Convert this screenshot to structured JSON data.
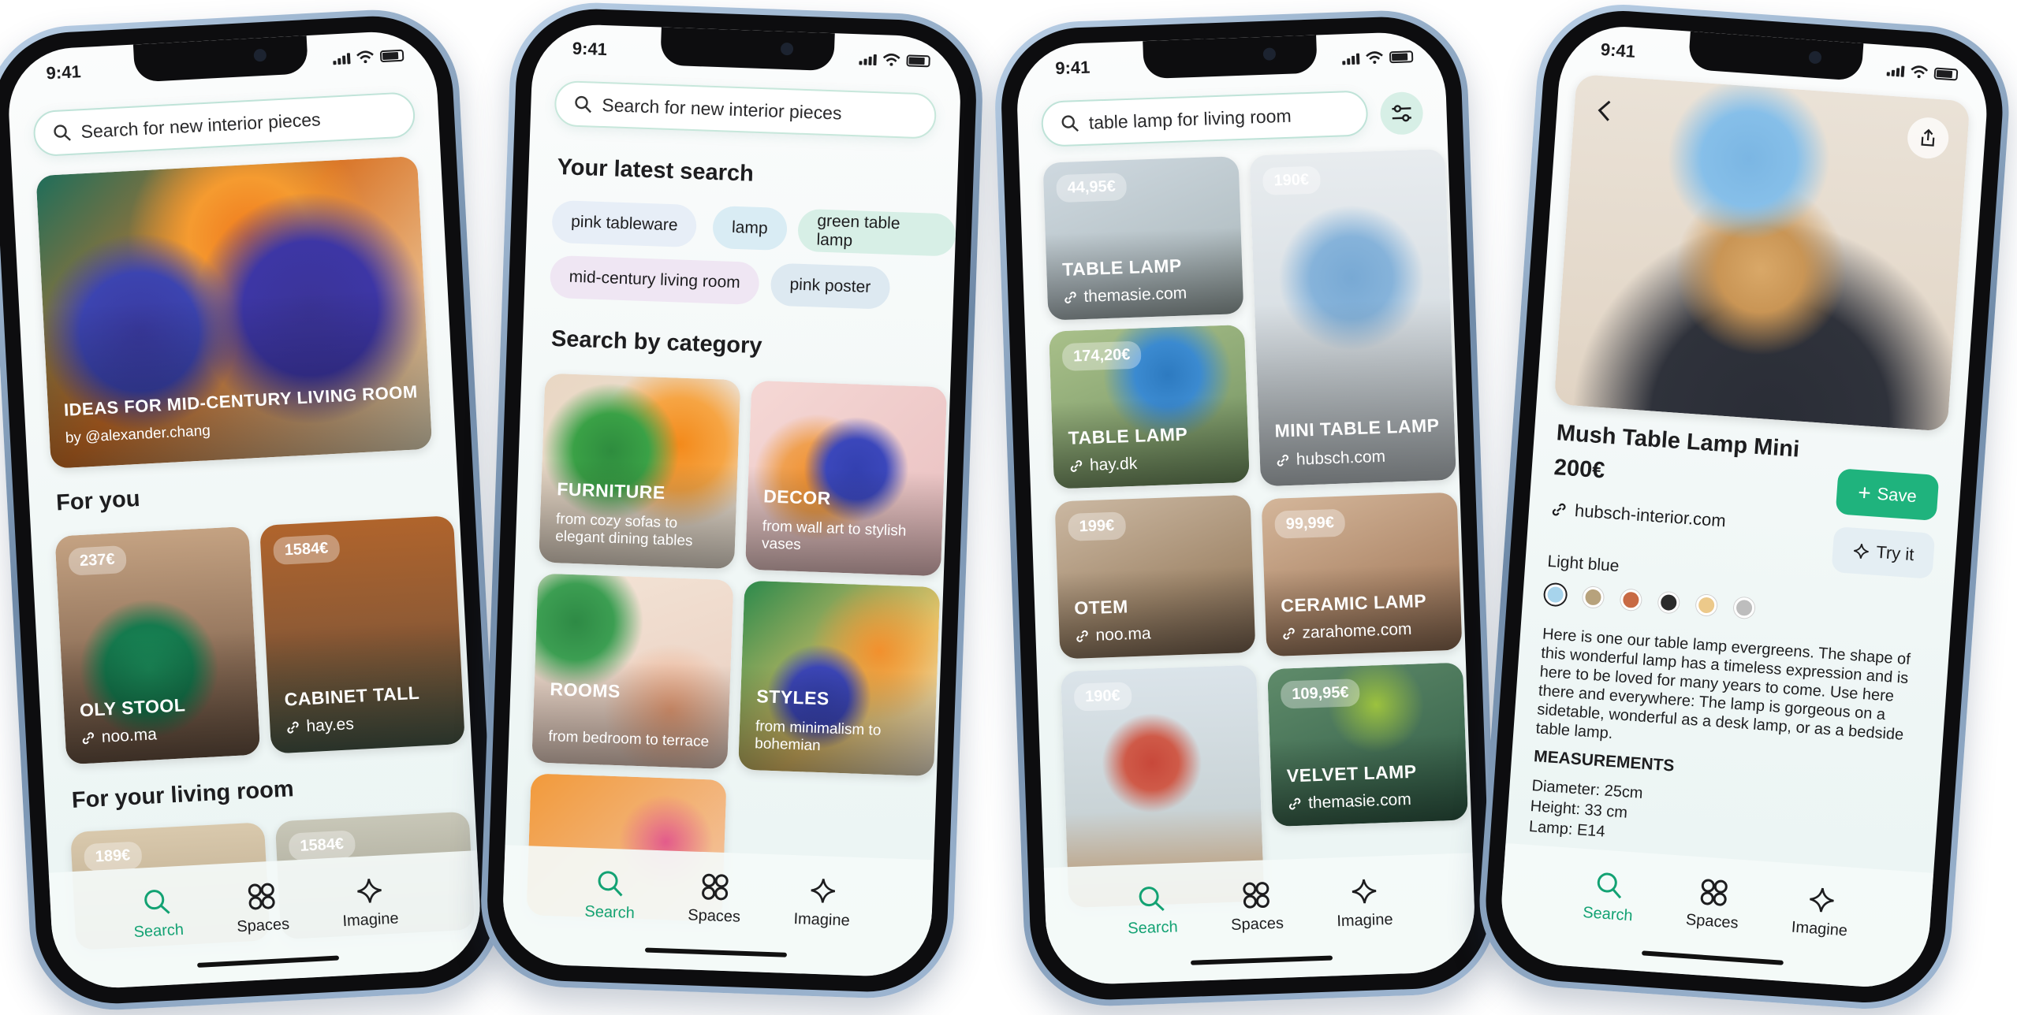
{
  "status": {
    "time": "9:41"
  },
  "colors": {
    "accent": "#13a273",
    "save_button": "#1fb37d"
  },
  "tabs": [
    {
      "label": "Search",
      "icon": "search-icon"
    },
    {
      "label": "Spaces",
      "icon": "spaces-icon"
    },
    {
      "label": "Imagine",
      "icon": "sparkle-icon"
    }
  ],
  "screen1": {
    "search_placeholder": "Search for new interior pieces",
    "hero": {
      "title": "IDEAS FOR MID-CENTURY LIVING ROOM",
      "author": "by @alexander.chang"
    },
    "for_you_title": "For you",
    "for_you": [
      {
        "price": "237€",
        "title": "OLY STOOL",
        "source": "noo.ma"
      },
      {
        "price": "1584€",
        "title": "CABINET TALL",
        "source": "hay.es"
      }
    ],
    "living_room_title": "For your living room",
    "living_room": [
      {
        "price": "189€"
      },
      {
        "price": "1584€"
      }
    ]
  },
  "screen2": {
    "search_placeholder": "Search for new interior pieces",
    "latest_title": "Your latest search",
    "chips": [
      "pink tableware",
      "lamp",
      "green table lamp",
      "mid-century living room",
      "pink poster"
    ],
    "category_title": "Search by category",
    "categories": [
      {
        "title": "FURNITURE",
        "subtitle": "from cozy sofas to elegant dining tables"
      },
      {
        "title": "DECOR",
        "subtitle": "from wall art to stylish vases"
      },
      {
        "title": "ROOMS",
        "subtitle": "from bedroom to terrace"
      },
      {
        "title": "STYLES",
        "subtitle": "from minimalism to bohemian"
      }
    ]
  },
  "screen3": {
    "search_value": "table lamp for living room",
    "filter_icon": "filter-icon",
    "results": [
      {
        "price": "44,95€",
        "title": "TABLE LAMP",
        "source": "themasie.com"
      },
      {
        "price": "190€",
        "title": "MINI TABLE LAMP",
        "source": "hubsch.com"
      },
      {
        "price": "174,20€",
        "title": "TABLE LAMP",
        "source": "hay.dk"
      },
      {
        "price": "199€",
        "title": "OTEM",
        "source": "noo.ma"
      },
      {
        "price": "99,99€",
        "title": "CERAMIC LAMP",
        "source": "zarahome.com"
      },
      {
        "price": "190€",
        "title": "",
        "source": ""
      },
      {
        "price": "109,95€",
        "title": "VELVET LAMP",
        "source": "themasie.com"
      }
    ]
  },
  "screen4": {
    "title": "Mush Table Lamp Mini",
    "price": "200€",
    "source": "hubsch-interior.com",
    "save_label": "Save",
    "try_label": "Try it",
    "color_label": "Light blue",
    "swatches": [
      "#a7d4ec",
      "#b7a27c",
      "#c86a44",
      "#2b2b2b",
      "#ecc98a",
      "#bdbdbd"
    ],
    "description": "Here is one our table lamp evergreens. The shape of this wonderful lamp has a timeless expression and is here to be loved for many years to come. Use here there and everywhere: The lamp is gorgeous on a sidetable, wonderful as a desk lamp, or as a bedside table lamp.",
    "measurements_title": "MEASUREMENTS",
    "measurements": [
      "Diameter: 25cm",
      "Height: 33 cm",
      "Lamp: E14"
    ]
  }
}
